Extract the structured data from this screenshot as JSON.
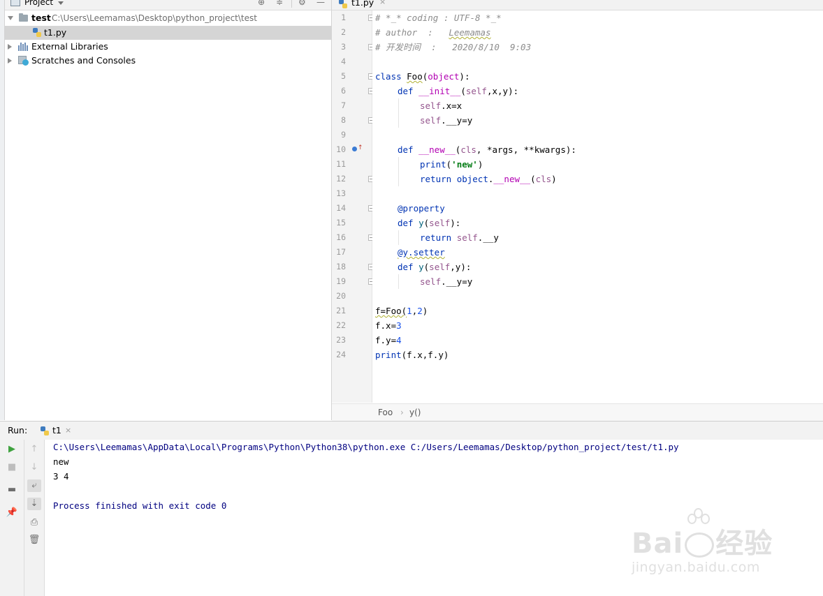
{
  "project_panel": {
    "title": "Project",
    "tree": [
      {
        "label": "test",
        "path": "C:\\Users\\Leemamas\\Desktop\\python_project\\test"
      },
      {
        "label": "t1.py"
      },
      {
        "label": "External Libraries"
      },
      {
        "label": "Scratches and Consoles"
      }
    ]
  },
  "editor": {
    "tab_label": "t1.py",
    "tab_close": "×",
    "line_numbers": [
      "1",
      "2",
      "3",
      "4",
      "5",
      "6",
      "7",
      "8",
      "9",
      "10",
      "11",
      "12",
      "13",
      "14",
      "15",
      "16",
      "17",
      "18",
      "19",
      "20",
      "21",
      "22",
      "23",
      "24"
    ],
    "code": {
      "l1": "# *_* coding : UTF-8 *_*",
      "l2a": "# author  :   ",
      "l2b": "Leemamas",
      "l3": "# 开发时间  :   2020/8/10  9:03",
      "l5_kw": "class ",
      "l5_name": "Foo",
      "l5_paren": "(",
      "l5_base": "object",
      "l5_end": "):",
      "l6_kw": "def ",
      "l6_fn": "__init__",
      "l6_a": "(",
      "l6_self": "self",
      "l6_b": ",x,y):",
      "l7_self": "self",
      "l7_rest": ".x=x",
      "l8_self": "self",
      "l8_rest": ".__y=y",
      "l10_kw": "def ",
      "l10_fn": "__new__",
      "l10_a": "(",
      "l10_cls": "cls",
      "l10_b": ", *args, **kwargs):",
      "l11_fn": "print",
      "l11_a": "(",
      "l11_str": "'new'",
      "l11_b": ")",
      "l12_kw": "return ",
      "l12_obj": "object",
      "l12_dot": ".",
      "l12_fn": "__new__",
      "l12_a": "(",
      "l12_cls": "cls",
      "l12_b": ")",
      "l14": "@property",
      "l15_kw": "def ",
      "l15_fn": "y",
      "l15_a": "(",
      "l15_self": "self",
      "l15_b": "):",
      "l16_kw": "return ",
      "l16_self": "self",
      "l16_rest": ".__y",
      "l17": "@y.setter",
      "l18_kw": "def ",
      "l18_fn": "y",
      "l18_a": "(",
      "l18_self": "self",
      "l18_b": ",y):",
      "l19_self": "self",
      "l19_rest": ".__y=y",
      "l21_a": "f=Foo(",
      "l21_n1": "1",
      "l21_c": ",",
      "l21_n2": "2",
      "l21_b": ")",
      "l22_a": "f.x=",
      "l22_n": "3",
      "l23_a": "f.y=",
      "l23_n": "4",
      "l24_fn": "print",
      "l24_rest": "(f.x,f.y)"
    },
    "breadcrumb": {
      "first": "Foo",
      "sep": "›",
      "second": "y()"
    }
  },
  "run_panel": {
    "label": "Run:",
    "tab_label": "t1",
    "tab_close": "×",
    "console": [
      "C:\\Users\\Leemamas\\AppData\\Local\\Programs\\Python\\Python38\\python.exe C:/Users/Leemamas/Desktop/python_project/test/t1.py",
      "new",
      "3 4",
      "",
      "Process finished with exit code 0"
    ]
  },
  "colors": {
    "keyword": "#0033b3",
    "self": "#94558d",
    "string": "#067d17",
    "number": "#1750eb",
    "decorator": "#9e880d",
    "comment": "#8c8c8c",
    "console_path": "#000080"
  }
}
